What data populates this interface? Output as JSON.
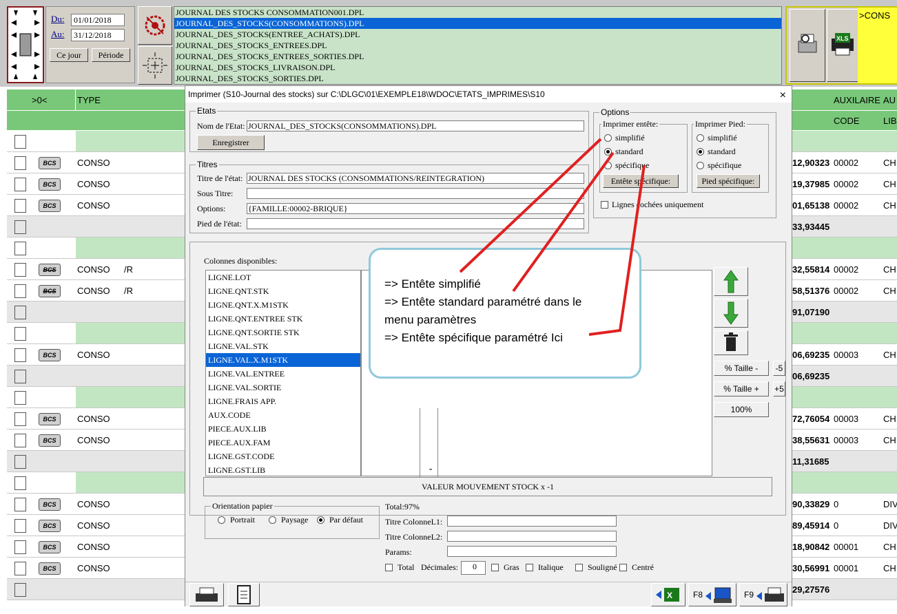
{
  "dates": {
    "du_label": "Du:",
    "du_value": "01/01/2018",
    "au_label": "Au:",
    "au_value": "31/12/2018",
    "ce_jour": "Ce jour",
    "periode": "Période"
  },
  "file_list": [
    "JOURNAL DES STOCKS CONSOMMATION001.DPL",
    "JOURNAL_DES_STOCKS(CONSOMMATIONS).DPL",
    "JOURNAL_DES_STOCKS(ENTREE_ACHATS).DPL",
    "JOURNAL_DES_STOCKS_ENTREES.DPL",
    "JOURNAL_DES_STOCKS_ENTREES_SORTIES.DPL",
    "JOURNAL_DES_STOCKS_LIVRAISON.DPL",
    "JOURNAL_DES_STOCKS_SORTIES.DPL"
  ],
  "file_selected_index": 1,
  "cons_tag": ">CONS",
  "grid": {
    "col_counter": ">0<",
    "col_type": "TYPE",
    "col_auxilaire": "AUXILAIRE",
    "col_au": "AU",
    "col_code": "CODE",
    "col_lib": "LIB",
    "bcs_label": "BCS",
    "rows": [
      {
        "kind": "group"
      },
      {
        "kind": "data",
        "type": "CONSO",
        "extra": "",
        "num": "12,90323",
        "code": "00002",
        "lib": "CH"
      },
      {
        "kind": "data",
        "type": "CONSO",
        "extra": "",
        "num": "19,37985",
        "code": "00002",
        "lib": "CH"
      },
      {
        "kind": "data",
        "type": "CONSO",
        "extra": "",
        "num": "01,65138",
        "code": "00002",
        "lib": "CH"
      },
      {
        "kind": "total",
        "num": "33,93445"
      },
      {
        "kind": "group"
      },
      {
        "kind": "data",
        "type": "CONSO",
        "extra": "/R",
        "num": "32,55814",
        "code": "00002",
        "lib": "CH",
        "crossed": true
      },
      {
        "kind": "data",
        "type": "CONSO",
        "extra": "/R",
        "num": "58,51376",
        "code": "00002",
        "lib": "CH",
        "crossed": true
      },
      {
        "kind": "total",
        "num": "91,07190"
      },
      {
        "kind": "group"
      },
      {
        "kind": "data",
        "type": "CONSO",
        "extra": "",
        "num": "06,69235",
        "code": "00003",
        "lib": "CH"
      },
      {
        "kind": "total",
        "num": "06,69235"
      },
      {
        "kind": "group"
      },
      {
        "kind": "data",
        "type": "CONSO",
        "extra": "",
        "num": "72,76054",
        "code": "00003",
        "lib": "CH"
      },
      {
        "kind": "data",
        "type": "CONSO",
        "extra": "",
        "num": "38,55631",
        "code": "00003",
        "lib": "CH"
      },
      {
        "kind": "total",
        "num": "11,31685"
      },
      {
        "kind": "group"
      },
      {
        "kind": "data",
        "type": "CONSO",
        "extra": "",
        "num": "90,33829",
        "code": "0",
        "lib": "DIV"
      },
      {
        "kind": "data",
        "type": "CONSO",
        "extra": "",
        "num": "89,45914",
        "code": "0",
        "lib": "DIV"
      },
      {
        "kind": "data",
        "type": "CONSO",
        "extra": "",
        "num": "18,90842",
        "code": "00001",
        "lib": "CH"
      },
      {
        "kind": "data",
        "type": "CONSO",
        "extra": "",
        "num": "30,56991",
        "code": "00001",
        "lib": "CH"
      },
      {
        "kind": "total",
        "num": "29,27576"
      }
    ]
  },
  "dialog": {
    "title": "Imprimer (S10-Journal des stocks)  sur C:\\DLGC\\01\\EXEMPLE18\\WDOC\\ETATS_IMPRIMES\\S10",
    "close": "×",
    "etats_title": "Etats",
    "nom_label": "Nom de l'Etat:",
    "nom_value": "JOURNAL_DES_STOCKS(CONSOMMATIONS).DPL",
    "enregistrer": "Enregistrer",
    "titres_title": "Titres",
    "titre_label": "Titre de l'état:",
    "titre_value": "JOURNAL DES STOCKS (CONSOMMATIONS/REINTEGRATION)",
    "sous_titre_label": "Sous Titre:",
    "sous_titre_value": "",
    "options_label": "Options:",
    "options_value": "{FAMILLE:00002-BRIQUE}",
    "pied_label": "Pied de l'état:",
    "pied_value": "",
    "options_title": "Options",
    "entete_title": "Imprimer entête:",
    "entete_simplifie": "simplifié",
    "entete_standard": "standard",
    "entete_specifique": "spécifique",
    "entete_btn": "Entête spécifique:",
    "pied_title": "Imprimer Pied:",
    "pied_simplifie": "simplifié",
    "pied_standard": "standard",
    "pied_specifique": "spécifique",
    "pied_btn": "Pied spécifique:",
    "lignes_cochees": "Lignes cochées uniquement",
    "colonnes_label": "Colonnes disponibles:",
    "colonnes": [
      "LIGNE.LOT",
      "LIGNE.QNT.STK",
      "LIGNE.QNT.X.M1STK",
      "LIGNE.QNT.ENTREE STK",
      "LIGNE.QNT.SORTIE STK",
      "LIGNE.VAL.STK",
      "LIGNE.VAL.X.M1STK",
      "LIGNE.VAL.ENTREE",
      "LIGNE.VAL.SORTIE",
      "LIGNE.FRAIS APP.",
      "AUX.CODE",
      "PIECE.AUX.LIB",
      "PIECE.AUX.FAM",
      "LIGNE.GST.CODE",
      "LIGNE.GST.LIB"
    ],
    "colonnes_selected_index": 6,
    "taille_minus": "% Taille -",
    "minus5": "-5",
    "taille_plus": "% Taille +",
    "plus5": "+5",
    "cent": "100%",
    "valeur_bar": "VALEUR MOUVEMENT STOCK  x -1",
    "orientation_title": "Orientation papier",
    "portrait": "Portrait",
    "paysage": "Paysage",
    "par_defaut": "Par défaut",
    "total_pct": "Total:97%",
    "titre_col1": "Titre ColonneL1:",
    "titre_col2": "Titre ColonneL2:",
    "params": "Params:",
    "total_chk": "Total",
    "decimales": "Décimales:",
    "decimales_value": "0",
    "gras": "Gras",
    "italique": "Italique",
    "souligne": "Souligné",
    "centre": "Centré",
    "f8": "F8",
    "f9": "F9"
  },
  "annotation": {
    "line1": "=>  Entête simplifié",
    "line2": "=>  Entête standard paramétré dans le",
    "line3": "menu paramètres",
    "line4": "=> Entête spécifique paramétré Ici"
  },
  "colors": {
    "green_header": "#79c879",
    "list_green": "#c9e3c9",
    "selection": "#0a64d6",
    "annotation_border": "#8ec9da",
    "arrow_red": "#e02020",
    "yellow": "#ffff3a"
  }
}
